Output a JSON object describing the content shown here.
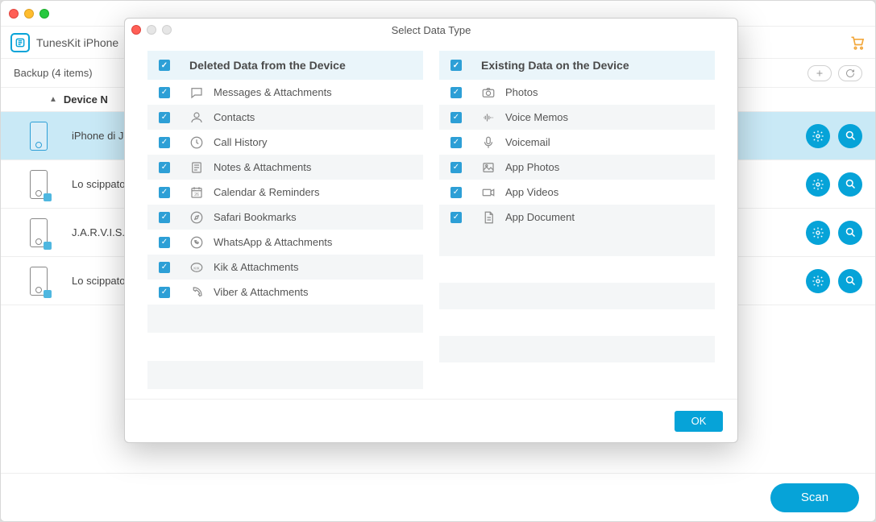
{
  "app": {
    "title": "TunesKit iPhone"
  },
  "subheader": {
    "label": "Backup (4 items)"
  },
  "table": {
    "header_name": "Device N"
  },
  "devices": [
    {
      "name": "iPhone di J."
    },
    {
      "name": "Lo scippato"
    },
    {
      "name": "J.A.R.V.I.S."
    },
    {
      "name": "Lo scippato"
    }
  ],
  "footer": {
    "scan": "Scan"
  },
  "modal": {
    "title": "Select Data Type",
    "ok": "OK",
    "left": {
      "header": "Deleted Data from the Device",
      "items": [
        {
          "label": "Messages & Attachments",
          "icon": "message"
        },
        {
          "label": "Contacts",
          "icon": "contact"
        },
        {
          "label": "Call History",
          "icon": "clock"
        },
        {
          "label": "Notes & Attachments",
          "icon": "note"
        },
        {
          "label": "Calendar & Reminders",
          "icon": "calendar"
        },
        {
          "label": "Safari Bookmarks",
          "icon": "compass"
        },
        {
          "label": "WhatsApp & Attachments",
          "icon": "whatsapp"
        },
        {
          "label": "Kik & Attachments",
          "icon": "kik"
        },
        {
          "label": "Viber & Attachments",
          "icon": "viber"
        }
      ]
    },
    "right": {
      "header": "Existing Data on the Device",
      "items": [
        {
          "label": "Photos",
          "icon": "camera"
        },
        {
          "label": "Voice Memos",
          "icon": "voice"
        },
        {
          "label": "Voicemail",
          "icon": "mic"
        },
        {
          "label": "App Photos",
          "icon": "image"
        },
        {
          "label": "App Videos",
          "icon": "video"
        },
        {
          "label": "App Document",
          "icon": "doc"
        }
      ]
    }
  }
}
